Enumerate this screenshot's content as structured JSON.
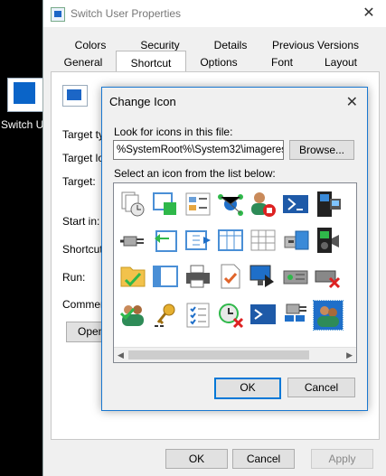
{
  "desktop": {
    "shortcut_label": "Switch Us"
  },
  "window": {
    "title": "Switch User Properties",
    "tabs_row1": [
      "Colors",
      "Security",
      "Details",
      "Previous Versions"
    ],
    "tabs_row2": [
      "General",
      "Shortcut",
      "Options",
      "Font",
      "Layout"
    ],
    "active_tab": "Shortcut",
    "fields": {
      "target_type": "Target typ",
      "target_location": "Target loc",
      "target": "Target:",
      "start_in": "Start in:",
      "shortcut_key": "Shortcut k",
      "run": "Run:",
      "comment": "Comment:"
    },
    "open_button": "Open",
    "buttons": {
      "ok": "OK",
      "cancel": "Cancel",
      "apply": "Apply"
    }
  },
  "dialog": {
    "title": "Change Icon",
    "look_label": "Look for icons in this file:",
    "path_value": "%SystemRoot%\\System32\\imageres",
    "browse_label": "Browse...",
    "list_label": "Select an icon from the list below:",
    "ok_label": "OK",
    "cancel_label": "Cancel",
    "icons": [
      "documents-clock-icon",
      "window-green-square-icon",
      "image-list-icon",
      "network-share-icon",
      "user-stop-icon",
      "powershell-icon",
      "media-tower-icon",
      "plug-connector-icon",
      "window-undo-icon",
      "window-arrow-icon",
      "table-view-icon",
      "network-grid-icon",
      "printer-drive-icon",
      "media-sound-icon",
      "folder-check-icon",
      "window-list-icon",
      "printer-icon",
      "document-checkmark-icon",
      "display-arrow-icon",
      "drive-dock-icon",
      "drive-error-icon",
      "users-check-icon",
      "key-password-icon",
      "checklist-icon",
      "clock-error-icon",
      "powershell-window-icon",
      "network-plug-icon",
      "switch-user-icon"
    ],
    "selected_icon": "switch-user-icon"
  }
}
